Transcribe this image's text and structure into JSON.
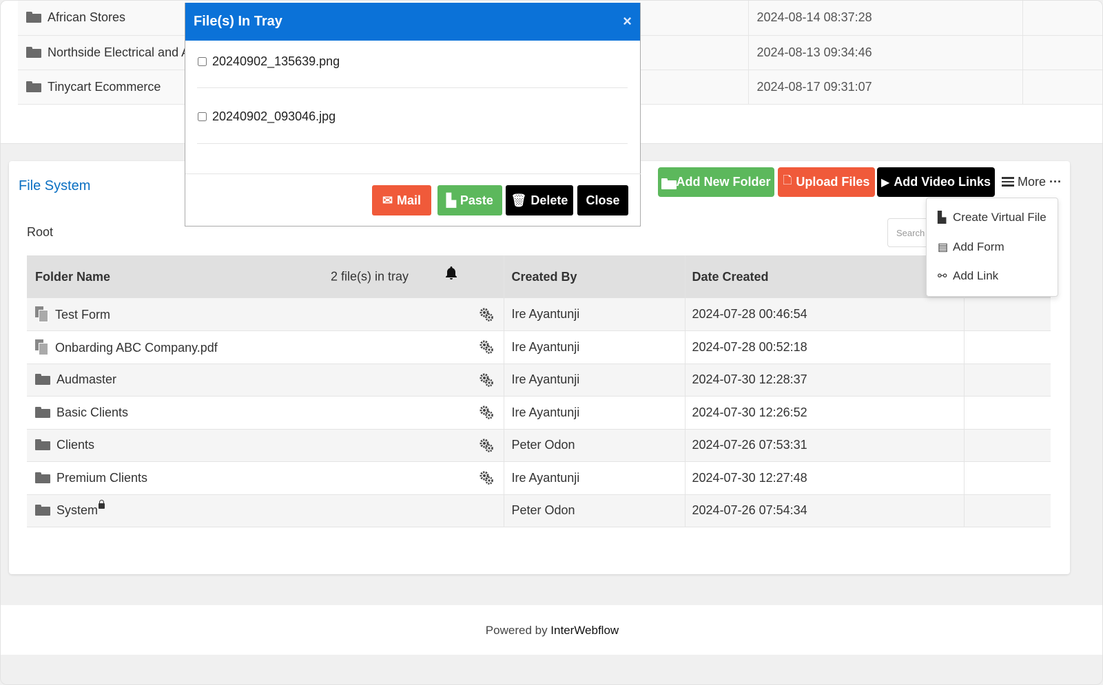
{
  "top_rows": [
    {
      "name": "African Stores",
      "date": "2024-08-14 08:37:28"
    },
    {
      "name": "Northside Electrical and A",
      "date": "2024-08-13 09:34:46"
    },
    {
      "name": "Tinycart Ecommerce",
      "date": "2024-08-17 09:31:07"
    }
  ],
  "file_system": {
    "title": "File System",
    "breadcrumb": "Root",
    "search_placeholder": "Search"
  },
  "toolbar": {
    "add_folder": "Add New Folder",
    "upload": "Upload Files",
    "video": "Add Video Links",
    "more": "More"
  },
  "dropdown": {
    "items": [
      "Create Virtual File",
      "Add Form",
      "Add Link"
    ]
  },
  "table": {
    "headers": {
      "name": "Folder Name",
      "tray": "2 file(s) in tray",
      "by": "Created By",
      "date": "Date Created"
    },
    "rows": [
      {
        "name": "Test Form",
        "by": "Ire Ayantunji",
        "date": "2024-07-28 00:46:54"
      },
      {
        "name": "Onbarding ABC Company.pdf",
        "by": "Ire Ayantunji",
        "date": "2024-07-28 00:52:18"
      },
      {
        "name": "Audmaster",
        "by": "Ire Ayantunji",
        "date": "2024-07-30 12:28:37"
      },
      {
        "name": "Basic Clients",
        "by": "Ire Ayantunji",
        "date": "2024-07-30 12:26:52"
      },
      {
        "name": "Clients",
        "by": "Peter Odon",
        "date": "2024-07-26 07:53:31"
      },
      {
        "name": "Premium Clients",
        "by": "Ire Ayantunji",
        "date": "2024-07-30 12:27:48"
      },
      {
        "name": "System",
        "by": "Peter Odon",
        "date": "2024-07-26 07:54:34"
      }
    ]
  },
  "modal": {
    "title": "File(s) In Tray",
    "close_glyph": "×",
    "files": [
      "20240902_135639.png",
      "20240902_093046.jpg"
    ],
    "buttons": {
      "mail": "Mail",
      "paste": "Paste",
      "delete": "Delete",
      "close": "Close"
    }
  },
  "footer": {
    "prefix": "Powered by ",
    "brand": "InterWebflow"
  },
  "colors": {
    "primary": "#0b72d8",
    "green": "#5cb85c",
    "red": "#f05a3a",
    "link": "#0a6fc2"
  }
}
